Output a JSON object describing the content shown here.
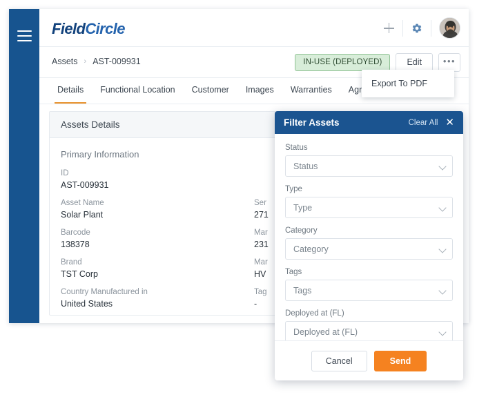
{
  "app": {
    "logo_part1": "Field",
    "logo_part2": "Circle"
  },
  "topbar": {
    "add_icon": "plus-icon",
    "settings_icon": "gear-icon",
    "avatar": "user-avatar"
  },
  "breadcrumb": {
    "root": "Assets",
    "separator": "›",
    "current": "AST-009931"
  },
  "header_actions": {
    "status_label": "IN-USE (DEPLOYED)",
    "edit_label": "Edit",
    "more_label": "•••"
  },
  "export_menu": {
    "items": [
      {
        "label": "Export To PDF"
      }
    ]
  },
  "tabs": [
    {
      "label": "Details",
      "active": true
    },
    {
      "label": "Functional Location",
      "active": false
    },
    {
      "label": "Customer",
      "active": false
    },
    {
      "label": "Images",
      "active": false
    },
    {
      "label": "Warranties",
      "active": false
    },
    {
      "label": "Agreements",
      "active": false
    }
  ],
  "details_panel": {
    "header": "Assets Details",
    "section_title": "Primary Information",
    "left_fields": [
      {
        "label": "ID",
        "value": "AST-009931"
      },
      {
        "label": "Asset Name",
        "value": "Solar Plant"
      },
      {
        "label": "Barcode",
        "value": "138378"
      },
      {
        "label": "Brand",
        "value": "TST Corp"
      },
      {
        "label": "Country Manufactured in",
        "value": "United States"
      }
    ],
    "right_fields": [
      {
        "label": "",
        "value": ""
      },
      {
        "label": "Ser",
        "value": "271"
      },
      {
        "label": "Mar",
        "value": "231"
      },
      {
        "label": "Mar",
        "value": "HV"
      },
      {
        "label": "Tag",
        "value": "-"
      }
    ]
  },
  "filter_panel": {
    "title": "Filter Assets",
    "clear_all": "Clear All",
    "close_icon": "✕",
    "groups": [
      {
        "label": "Status",
        "placeholder": "Status"
      },
      {
        "label": "Type",
        "placeholder": "Type"
      },
      {
        "label": "Category",
        "placeholder": "Category"
      },
      {
        "label": "Tags",
        "placeholder": "Tags"
      },
      {
        "label": "Deployed at (FL)",
        "placeholder": "Deployed at (FL)"
      }
    ],
    "cancel_label": "Cancel",
    "send_label": "Send"
  },
  "colors": {
    "sidebar": "#17548f",
    "accent_orange": "#f58220",
    "tab_underline": "#e8922e",
    "status_bg": "#d8edd9",
    "status_border": "#8fc294",
    "filter_header": "#1b5490",
    "logo_dark": "#12427c",
    "logo_light": "#2463ad"
  }
}
